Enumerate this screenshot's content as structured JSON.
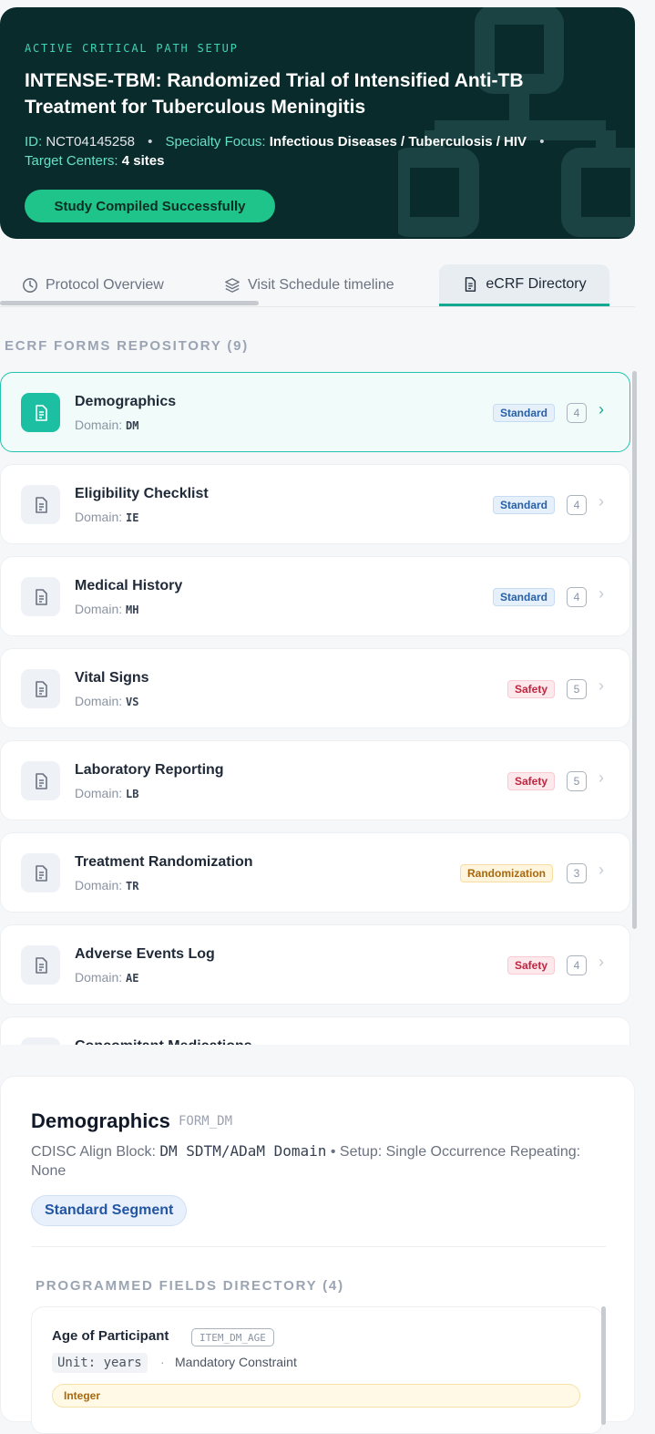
{
  "hero": {
    "kicker": "ACTIVE CRITICAL PATH SETUP",
    "title": "INTENSE-TBM: Randomized Trial of Intensified Anti-TB Treatment for Tuberculous Meningitis",
    "id_label": "ID:",
    "id_value": "NCT04145258",
    "specialty_label": "Specialty Focus:",
    "specialty_value": "Infectious Diseases / Tuberculosis / HIV",
    "centers_label": "Target Centers:",
    "centers_value": "4 sites",
    "separator": "•",
    "badge": "Study Compiled Successfully"
  },
  "tabs": [
    {
      "label": "Protocol Overview",
      "icon": "clock-icon"
    },
    {
      "label": "Visit Schedule timeline",
      "icon": "layers-icon"
    },
    {
      "label": "eCRF Directory",
      "icon": "document-icon",
      "active": true
    }
  ],
  "forms_section_label": "ECRF FORMS REPOSITORY (9)",
  "domain_prefix": "Domain:",
  "forms": [
    {
      "name": "Demographics",
      "domain": "DM",
      "tag": "Standard",
      "count": "4",
      "active": true
    },
    {
      "name": "Eligibility Checklist",
      "domain": "IE",
      "tag": "Standard",
      "count": "4"
    },
    {
      "name": "Medical History",
      "domain": "MH",
      "tag": "Standard",
      "count": "4"
    },
    {
      "name": "Vital Signs",
      "domain": "VS",
      "tag": "Safety",
      "count": "5"
    },
    {
      "name": "Laboratory Reporting",
      "domain": "LB",
      "tag": "Safety",
      "count": "5"
    },
    {
      "name": "Treatment Randomization",
      "domain": "TR",
      "tag": "Randomization",
      "count": "3"
    },
    {
      "name": "Adverse Events Log",
      "domain": "AE",
      "tag": "Safety",
      "count": "4"
    },
    {
      "name": "Concomitant Medications",
      "domain": "",
      "tag": "",
      "count": ""
    }
  ],
  "detail": {
    "title": "Demographics",
    "code": "FORM_DM",
    "align_label": "CDISC Align Block:",
    "align_value": "DM SDTM/ADaM Domain",
    "setup_text": "• Setup: Single Occurrence Repeating: None",
    "segment": "Standard Segment",
    "fields_label": "PROGRAMMED FIELDS DIRECTORY (4)",
    "field": {
      "name": "Age of Participant",
      "code": "ITEM_DM_AGE",
      "unit": "Unit: years",
      "separator": "·",
      "constraint": "Mandatory Constraint",
      "type": "Integer"
    }
  },
  "colors": {
    "hero_bg": "#0a2b2c",
    "accent": "#1dbfa3",
    "badge": "#1ec48a",
    "standard": "#2860a6",
    "safety": "#c0253f",
    "randomization": "#a8680d"
  }
}
